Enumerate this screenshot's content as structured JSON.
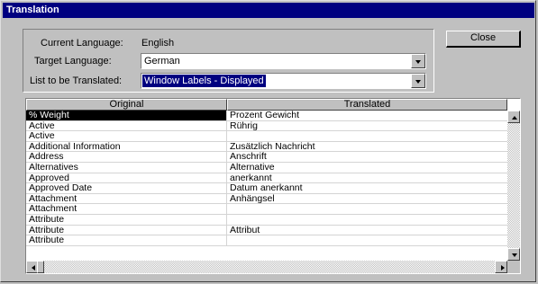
{
  "window": {
    "title": "Translation"
  },
  "settings": {
    "current_language_label": "Current Language:",
    "current_language_value": "English",
    "target_language_label": "Target Language:",
    "target_language_value": "German",
    "list_label": "List to be Translated:",
    "list_value": "Window Labels - Displayed"
  },
  "buttons": {
    "close_label": "Close"
  },
  "grid": {
    "columns": [
      "Original",
      "Translated"
    ],
    "rows": [
      [
        "% Weight",
        "Prozent Gewicht"
      ],
      [
        "Active",
        "Rührig"
      ],
      [
        "Active",
        ""
      ],
      [
        "Additional Information",
        "Zusätzlich Nachricht"
      ],
      [
        "Address",
        "Anschrift"
      ],
      [
        "Alternatives",
        "Alternative"
      ],
      [
        "Approved",
        "anerkannt"
      ],
      [
        "Approved Date",
        "Datum anerkannt"
      ],
      [
        "Attachment",
        "Anhängsel"
      ],
      [
        "Attachment",
        ""
      ],
      [
        "Attribute",
        ""
      ],
      [
        "Attribute",
        "Attribut"
      ],
      [
        "Attribute",
        ""
      ]
    ],
    "selected_row": 0
  },
  "icons": {
    "dropdown": "chevron-down-icon",
    "scroll_up": "scroll-up-arrow-icon",
    "scroll_down": "scroll-down-arrow-icon",
    "scroll_left": "scroll-left-arrow-icon",
    "scroll_right": "scroll-right-arrow-icon"
  },
  "colors": {
    "title_bar": "#000080",
    "face": "#c0c0c0",
    "selection": "#000080",
    "selected_cell": "#000000"
  }
}
